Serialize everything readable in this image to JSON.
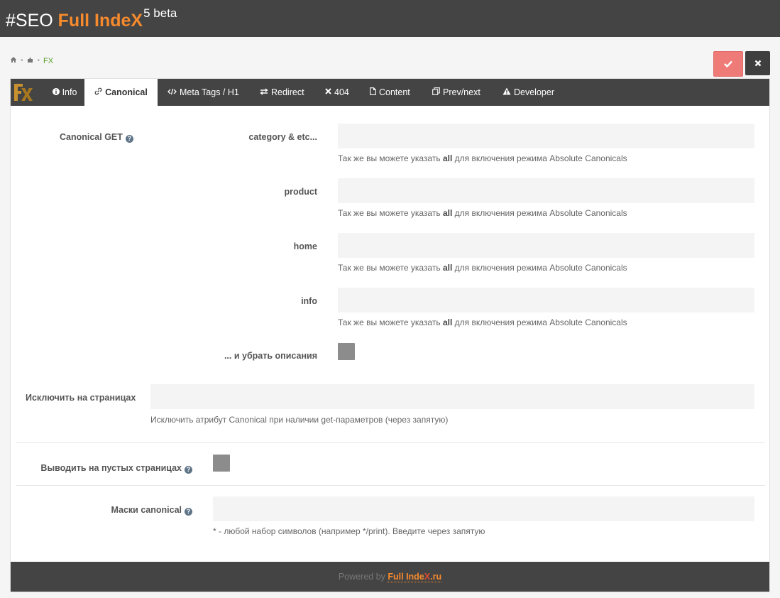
{
  "header": {
    "hash_seo": "#SEO ",
    "brand": "Full IndeX",
    "version": "5 beta"
  },
  "breadcrumb": {
    "home_icon": "home-icon",
    "module_icon": "puzzle-icon",
    "current": "FX"
  },
  "actions": {
    "save_icon": "check-icon",
    "close_icon": "close-icon",
    "save_color": "#ef7b78",
    "close_color": "#3f3f3f"
  },
  "tabs": [
    {
      "label": "Info",
      "icon": "info-icon"
    },
    {
      "label": "Canonical",
      "icon": "link-icon",
      "active": true
    },
    {
      "label": "Meta Tags / H1",
      "icon": "code-icon"
    },
    {
      "label": "Redirect",
      "icon": "exchange-icon"
    },
    {
      "label": "404",
      "icon": "times-icon"
    },
    {
      "label": "Content",
      "icon": "file-icon"
    },
    {
      "label": "Prev/next",
      "icon": "clone-icon"
    },
    {
      "label": "Developer",
      "icon": "warning-icon"
    }
  ],
  "canonical_get": {
    "label": "Canonical GET",
    "fields": [
      {
        "label": "category & etc...",
        "value": "",
        "hint_pre": "Так же вы можете указать ",
        "hint_bold": "all",
        "hint_post": " для включения режима Absolute Canonicals"
      },
      {
        "label": "product",
        "value": "",
        "hint_pre": "Так же вы можете указать ",
        "hint_bold": "all",
        "hint_post": " для включения режима Absolute Canonicals"
      },
      {
        "label": "home",
        "value": "",
        "hint_pre": "Так же вы можете указать ",
        "hint_bold": "all",
        "hint_post": " для включения режима Absolute Canonicals"
      },
      {
        "label": "info",
        "value": "",
        "hint_pre": "Так же вы можете указать ",
        "hint_bold": "all",
        "hint_post": " для включения режима Absolute Canonicals"
      }
    ],
    "remove_desc_label": "... и убрать описания"
  },
  "exclude": {
    "label": "Исключить на страницах",
    "value": "",
    "hint": "Исключить атрибут Canonical при наличии get-параметров (через запятую)"
  },
  "empty_pages": {
    "label": "Выводить на пустых страницах"
  },
  "masks": {
    "label": "Маски canonical",
    "value": "",
    "hint": "* - любой набор символов (например */print). Введите через запятую"
  },
  "footer": {
    "powered": "Powered by ",
    "brand": "Full Inde",
    "brand_x": "X",
    "brand_ru": ".ru"
  },
  "colors": {
    "accent": "#f68a2d",
    "dark": "#444444"
  }
}
